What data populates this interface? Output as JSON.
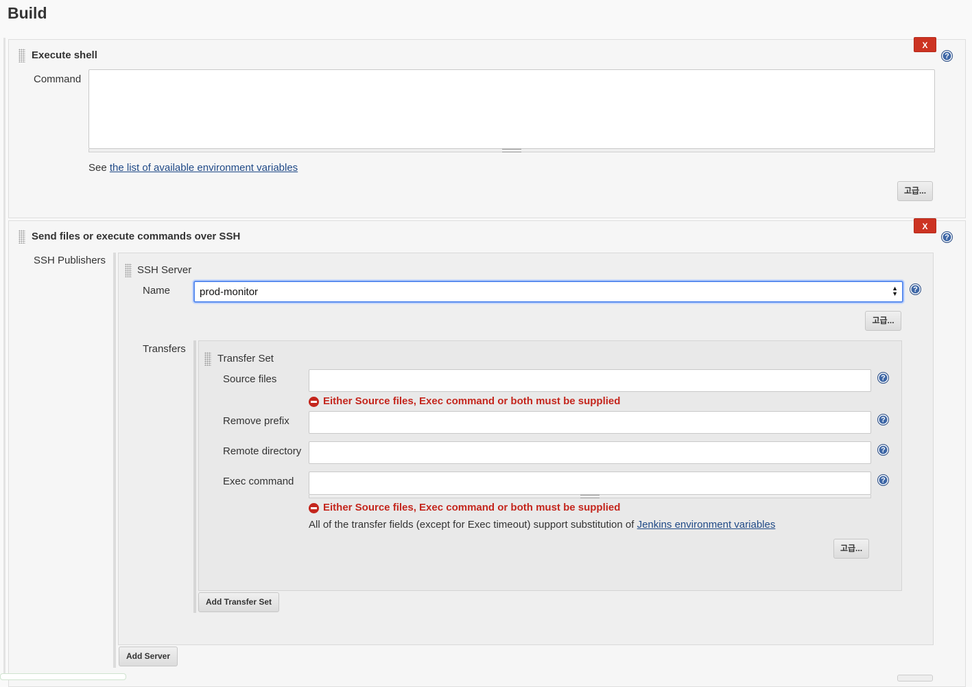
{
  "page": {
    "section_title": "Build"
  },
  "execute_shell": {
    "title": "Execute shell",
    "command_label": "Command",
    "command_value": "",
    "env_prefix": "See ",
    "env_link": "the list of available environment variables",
    "advanced_label": "고급...",
    "delete_label": "X",
    "help_icon": "?"
  },
  "ssh": {
    "title": "Send files or execute commands over SSH",
    "delete_label": "X",
    "help_icon": "?",
    "publishers_label": "SSH Publishers",
    "server": {
      "title": "SSH Server",
      "name_label": "Name",
      "name_value": "prod-monitor",
      "advanced_label": "고급...",
      "transfers_label": "Transfers",
      "transfer_set": {
        "title": "Transfer Set",
        "source_files_label": "Source files",
        "source_files_value": "",
        "source_files_error": "Either Source files, Exec command or both must be supplied",
        "remove_prefix_label": "Remove prefix",
        "remove_prefix_value": "",
        "remote_directory_label": "Remote directory",
        "remote_directory_value": "",
        "exec_command_label": "Exec command",
        "exec_command_value": "",
        "exec_command_error": "Either Source files, Exec command or both must be supplied",
        "note_prefix": "All of the transfer fields (except for Exec timeout) support substitution of ",
        "note_link": "Jenkins environment variables",
        "advanced_label": "고급..."
      },
      "add_transfer_set_label": "Add Transfer Set"
    },
    "add_server_label": "Add Server"
  },
  "colors": {
    "error": "#c4261d",
    "delete": "#cc3322",
    "help": "#3e67a6",
    "link": "#204a87"
  }
}
